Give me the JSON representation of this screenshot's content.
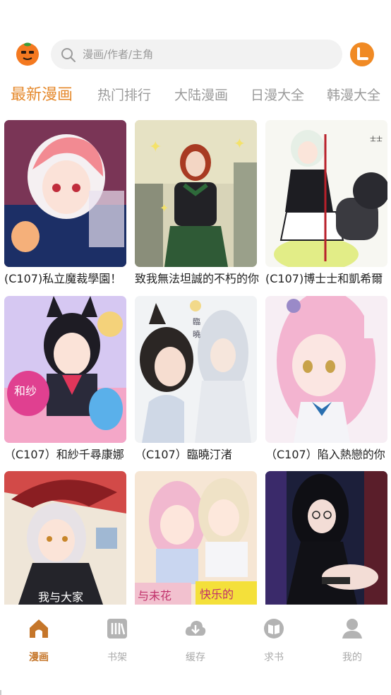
{
  "header": {
    "search_placeholder": "漫画/作者/主角",
    "logo_icon": "orange-fruit-icon",
    "history_icon": "clock-icon"
  },
  "tabs": [
    {
      "label": "最新漫画",
      "active": true
    },
    {
      "label": "热门排行",
      "active": false
    },
    {
      "label": "大陆漫画",
      "active": false
    },
    {
      "label": "日漫大全",
      "active": false
    },
    {
      "label": "韩漫大全",
      "active": false
    }
  ],
  "comics": [
    {
      "title": "(C107)私立魔裁學園！"
    },
    {
      "title": "致我無法坦誠的不朽的你"
    },
    {
      "title": "(C107)博士士和凱希爾"
    },
    {
      "title": "（C107）和紗千尋康娜"
    },
    {
      "title": "（C107）臨曉汀渚"
    },
    {
      "title": "（C107）陷入熱戀的你"
    },
    {
      "title": ""
    },
    {
      "title": ""
    },
    {
      "title": ""
    }
  ],
  "nav": [
    {
      "label": "漫画",
      "icon": "home-icon",
      "active": true
    },
    {
      "label": "书架",
      "icon": "bookshelf-icon",
      "active": false
    },
    {
      "label": "缓存",
      "icon": "cloud-download-icon",
      "active": false
    },
    {
      "label": "求书",
      "icon": "book-request-icon",
      "active": false
    },
    {
      "label": "我的",
      "icon": "user-icon",
      "active": false
    }
  ],
  "colors": {
    "accent": "#e5892c",
    "inactive": "#9a9a9a"
  }
}
